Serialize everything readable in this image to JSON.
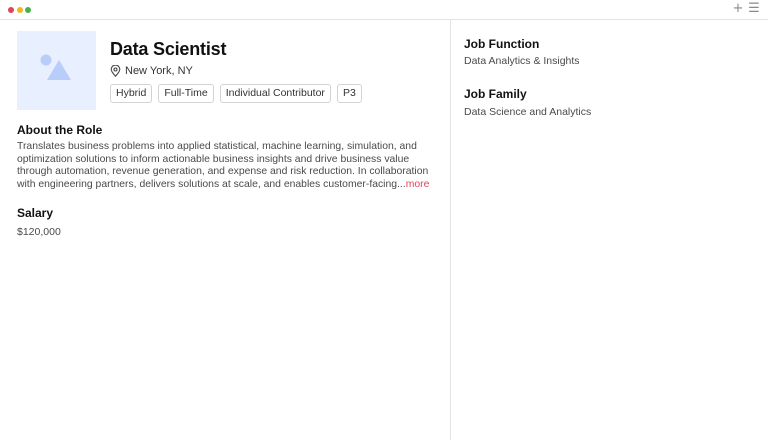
{
  "window": {
    "controls": {
      "red": "#e0445a",
      "yellow": "#f2b51c",
      "green": "#48b04f"
    },
    "icons": [
      "plus-icon",
      "menu-icon"
    ],
    "plus_glyph": "+",
    "menu_glyph": "☰"
  },
  "job": {
    "title": "Data Scientist",
    "location": "New York, NY",
    "tags": [
      "Hybrid",
      "Full-Time",
      "Individual Contributor",
      "P3"
    ]
  },
  "about": {
    "heading": "About the Role",
    "text": "Translates business problems into applied statistical, machine learning, simulation, and optimization solutions to inform actionable business insights and drive business value through automation, revenue generation, and expense and risk reduction. In collaboration with engineering partners, delivers solutions at scale, and enables customer-facing...",
    "more_label": "more"
  },
  "salary": {
    "heading": "Salary",
    "value": "$120,000"
  },
  "sidebar": {
    "job_function": {
      "heading": "Job Function",
      "value": "Data Analytics & Insights"
    },
    "job_family": {
      "heading": "Job Family",
      "value": "Data Science and Analytics"
    }
  },
  "colors": {
    "accent": "#e0445a",
    "thumbnail_bg": "#e8efff",
    "thumbnail_icon": "#b9cdfb"
  }
}
